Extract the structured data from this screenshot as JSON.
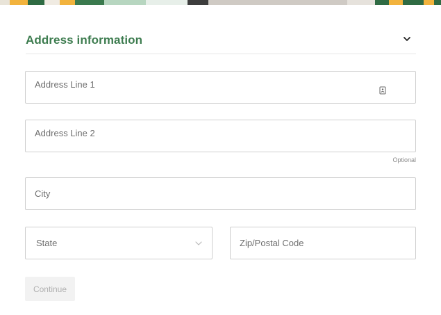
{
  "section": {
    "title": "Address information",
    "expanded": true
  },
  "fields": {
    "address_line_1": {
      "placeholder": "Address Line 1",
      "value": ""
    },
    "address_line_2": {
      "placeholder": "Address Line 2",
      "value": "",
      "hint": "Optional"
    },
    "city": {
      "placeholder": "City",
      "value": ""
    },
    "state": {
      "selected": "State"
    },
    "zip": {
      "placeholder": "Zip/Postal Code",
      "value": ""
    }
  },
  "actions": {
    "continue_label": "Continue",
    "continue_enabled": false
  },
  "icons": {
    "section_toggle": "chevron-down-icon",
    "address_autofill": "contact-card-icon",
    "state_dropdown": "chevron-down-icon"
  },
  "colors": {
    "accent_green": "#3d7c4f",
    "border": "#cfcfcf",
    "disabled_button_bg": "#f2f2f2"
  }
}
